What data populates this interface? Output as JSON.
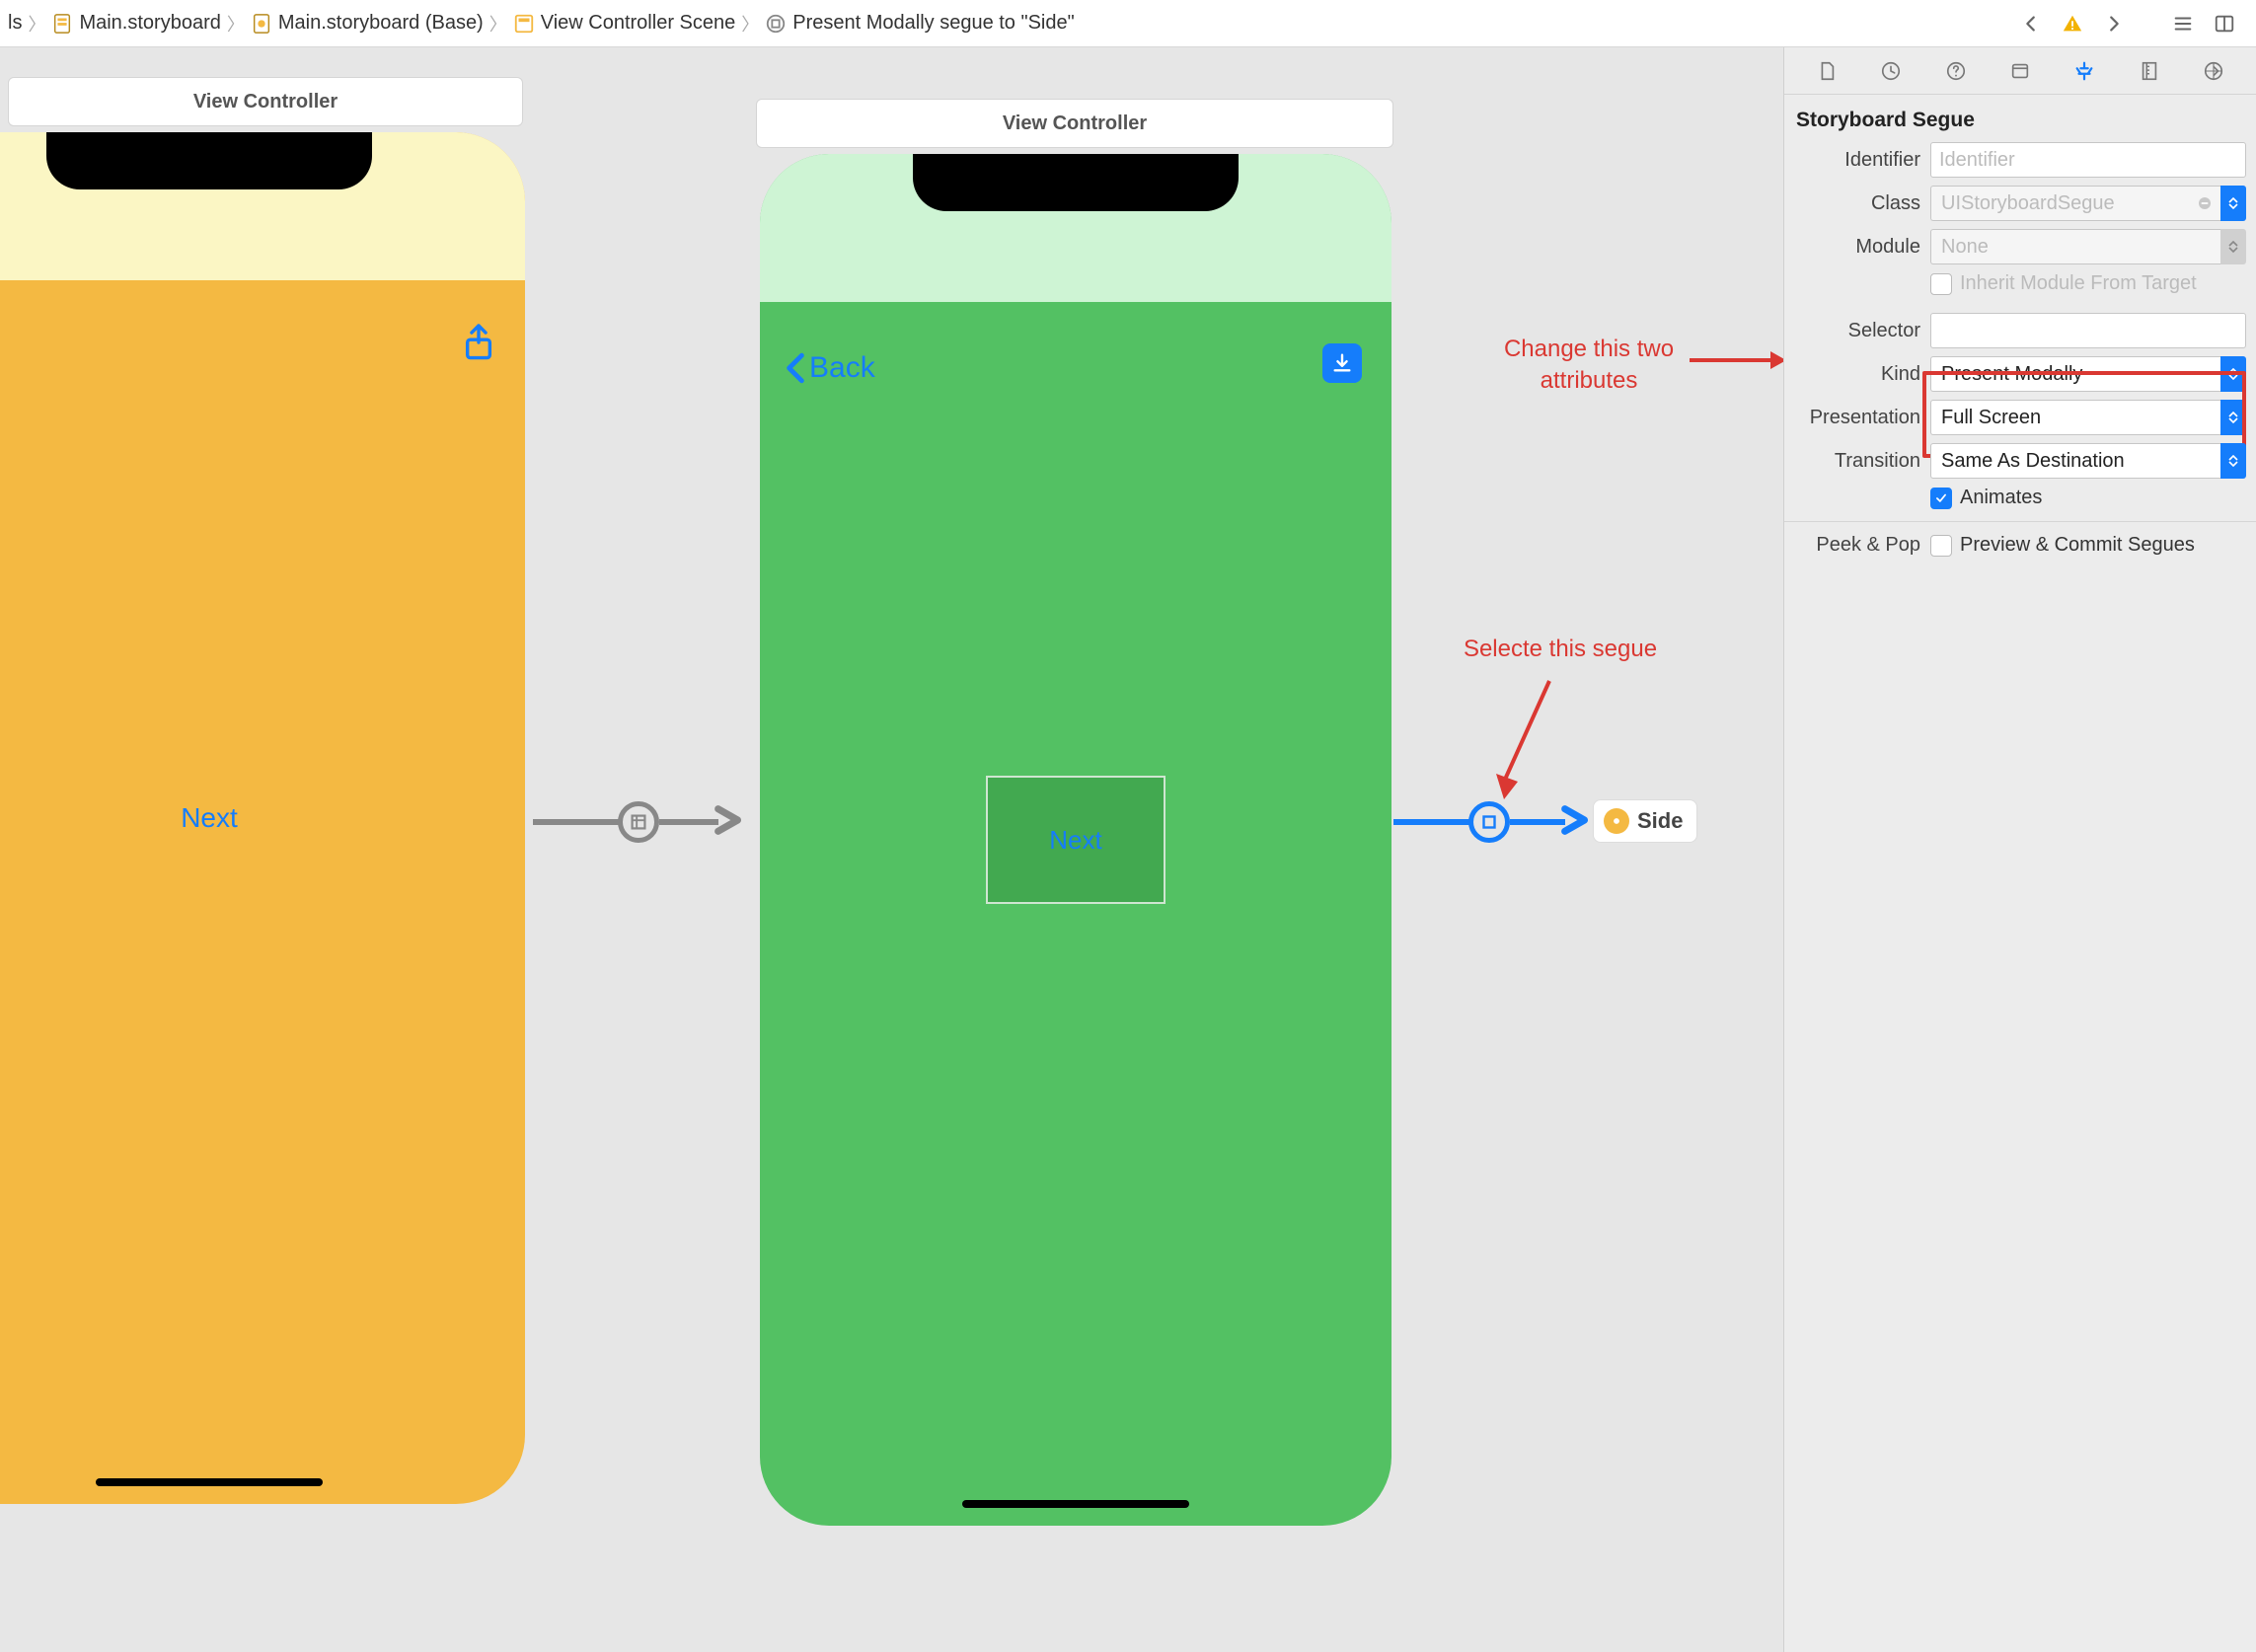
{
  "breadcrumbs": {
    "item0": "ls",
    "item1": "Main.storyboard",
    "item2": "Main.storyboard (Base)",
    "item3": "View Controller Scene",
    "item4": "Present Modally segue to \"Side\""
  },
  "canvas": {
    "scene1_title": "View Controller",
    "scene2_title": "View Controller",
    "scene1_button": "Next",
    "scene2_back": "Back",
    "scene2_button": "Next",
    "side_chip": "Side"
  },
  "annotations": {
    "change_attrs_line1": "Change this two",
    "change_attrs_line2": "attributes",
    "select_segue": "Selecte this segue"
  },
  "inspector": {
    "heading_segue": "Storyboard Segue",
    "labels": {
      "identifier": "Identifier",
      "class": "Class",
      "module": "Module",
      "inherit": "Inherit Module From Target",
      "selector": "Selector",
      "kind": "Kind",
      "presentation": "Presentation",
      "transition": "Transition",
      "animates": "Animates",
      "peekpop": "Peek & Pop",
      "peekpop_val": "Preview & Commit Segues"
    },
    "placeholders": {
      "identifier": "Identifier",
      "class": "UIStoryboardSegue",
      "module": "None"
    },
    "values": {
      "selector": "",
      "kind": "Present Modally",
      "presentation": "Full Screen",
      "transition": "Same As Destination",
      "animates_checked": true,
      "inherit_checked": false,
      "peekpop_checked": false
    }
  }
}
